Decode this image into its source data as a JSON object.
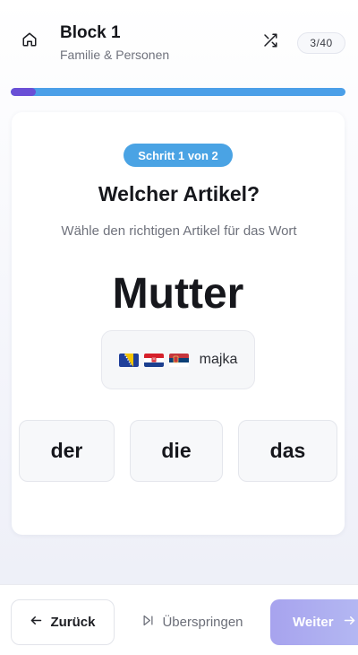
{
  "header": {
    "title": "Block 1",
    "subtitle": "Familie & Personen",
    "counter": "3/40",
    "icons": {
      "home": "home-icon",
      "shuffle": "shuffle-icon"
    }
  },
  "progress": {
    "fraction": 0.075,
    "fill_color": "#6a4fd6",
    "track_color": "#4b9fe8"
  },
  "card": {
    "step_badge": "Schritt 1 von 2",
    "question": "Welcher Artikel?",
    "instruction": "Wähle den richtigen Artikel für das Wort",
    "word": "Mutter",
    "translation": {
      "flags": [
        "bosnia-flag-icon",
        "croatia-flag-icon",
        "serbia-flag-icon"
      ],
      "text": "majka"
    },
    "options": [
      "der",
      "die",
      "das"
    ]
  },
  "footer": {
    "back_label": "Zurück",
    "skip_label": "Überspringen",
    "next_label": "Weiter"
  },
  "colors": {
    "accent": "#4aa3e4",
    "primary": "#6a4fd6",
    "next_button": "#a7a3ee"
  }
}
